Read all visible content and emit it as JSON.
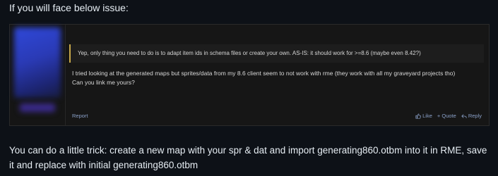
{
  "intro_text": "If you will face below issue:",
  "post": {
    "quote_text": "Yep, only thing you need to do is to adapt item ids in schema files or create your own. AS-IS: it should work for >=8.6 (maybe even 8.42?)",
    "body_line1": "I tried looking at the generated maps but sprites/data from my 8.6 client seem to not work with rme (they work with all my graveyard projects tho)",
    "body_line2": "Can you link me yours?",
    "report_label": "Report",
    "like_label": "Like",
    "quote_label": "+ Quote",
    "reply_label": "Reply",
    "icons": {
      "like": "thumbs-up-icon",
      "reply": "reply-icon"
    },
    "colors": {
      "accent": "#c7a84a",
      "link": "#8aa0c8"
    }
  },
  "outro_text": "You can do a little trick: create a new map with your spr & dat and import generating860.otbm into it in RME, save it and replace with initial generating860.otbm"
}
